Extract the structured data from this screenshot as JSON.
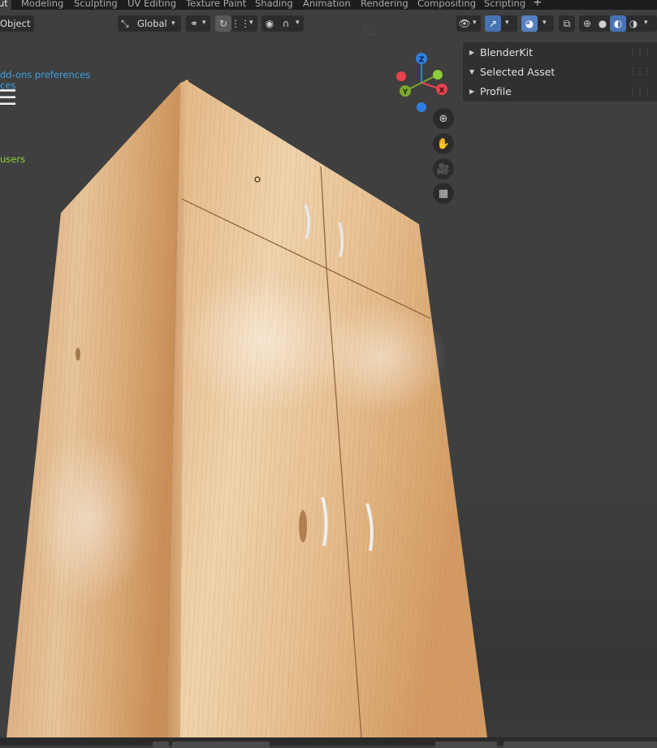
{
  "workspace_tabs": [
    {
      "label": "ut",
      "active": true
    },
    {
      "label": "Modeling",
      "active": false
    },
    {
      "label": "Sculpting",
      "active": false
    },
    {
      "label": "UV Editing",
      "active": false
    },
    {
      "label": "Texture Paint",
      "active": false
    },
    {
      "label": "Shading",
      "active": false
    },
    {
      "label": "Animation",
      "active": false
    },
    {
      "label": "Rendering",
      "active": false
    },
    {
      "label": "Compositing",
      "active": false
    },
    {
      "label": "Scripting",
      "active": false
    },
    {
      "label": "+",
      "active": false
    }
  ],
  "viewport_header": {
    "mode_label": "Object",
    "transform_orientation": "Global"
  },
  "overlay_text": {
    "addons_line1": "dd-ons preferences",
    "addons_line2": "ces",
    "menu_glyph": "☰",
    "users_line": "users"
  },
  "gizmo": {
    "x_label": "X",
    "y_label": "Y",
    "z_label": "Z",
    "colors": {
      "x": "#e8424f",
      "y": "#7da82f",
      "z": "#2f7fe0"
    }
  },
  "npanel": {
    "items": [
      {
        "label": "BlenderKit",
        "expanded": false
      },
      {
        "label": "Selected Asset",
        "expanded": true
      },
      {
        "label": "Profile",
        "expanded": false
      }
    ]
  },
  "scene": {
    "object": "wooden cabinet",
    "wood_color": "#d9a972"
  }
}
